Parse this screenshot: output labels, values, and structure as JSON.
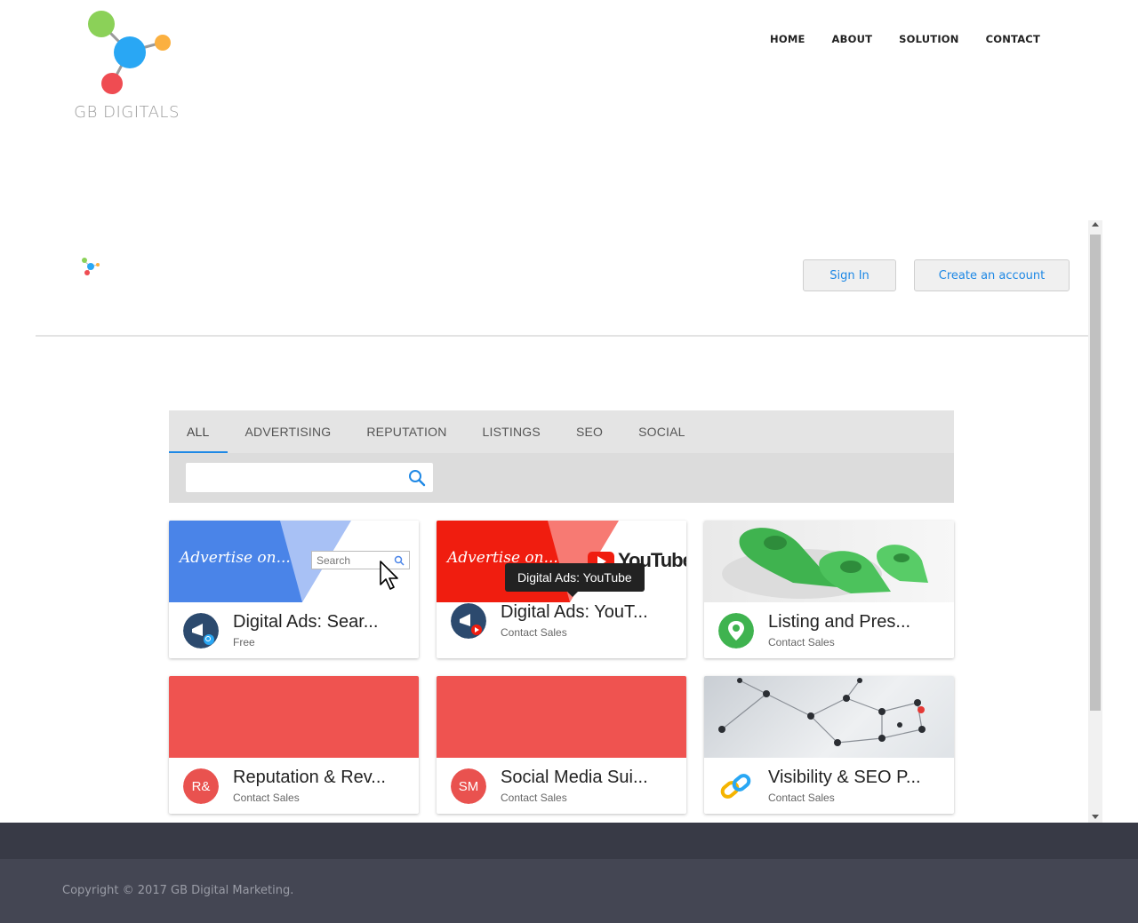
{
  "brand": {
    "name": "GB DIGITALS"
  },
  "nav": {
    "items": [
      "HOME",
      "ABOUT",
      "SOLUTION",
      "CONTACT"
    ]
  },
  "account": {
    "sign_in": "Sign In",
    "create": "Create an account"
  },
  "catalog": {
    "tabs": [
      "ALL",
      "ADVERTISING",
      "REPUTATION",
      "LISTINGS",
      "SEO",
      "SOCIAL"
    ],
    "active_tab": "ALL",
    "search": {
      "value": "",
      "placeholder": ""
    },
    "cards": [
      {
        "title": "Digital Ads: Sear...",
        "subtitle": "Free",
        "banner_text": "Advertise on...",
        "banner_search": "Search",
        "icon": "megaphone-search-icon"
      },
      {
        "title": "Digital Ads: YouT...",
        "subtitle": "Contact Sales",
        "banner_text": "Advertise on...",
        "banner_brand": "YouTube",
        "icon": "megaphone-youtube-icon"
      },
      {
        "title": "Listing and Pres...",
        "subtitle": "Contact Sales",
        "icon": "map-pin-icon"
      },
      {
        "title": "Reputation & Rev...",
        "subtitle": "Contact Sales",
        "initials": "R&",
        "icon": "initials-avatar"
      },
      {
        "title": "Social Media Sui...",
        "subtitle": "Contact Sales",
        "initials": "SM",
        "icon": "initials-avatar"
      },
      {
        "title": "Visibility & SEO P...",
        "subtitle": "Contact Sales",
        "icon": "chain-link-icon"
      }
    ],
    "tooltip": "Digital Ads: YouTube"
  },
  "footer": {
    "copyright": "Copyright © 2017 GB Digital Marketing."
  },
  "colors": {
    "accent": "#1e88e5",
    "red": "#e9524f",
    "footer_dark": "#383a46",
    "footer": "#444653"
  }
}
